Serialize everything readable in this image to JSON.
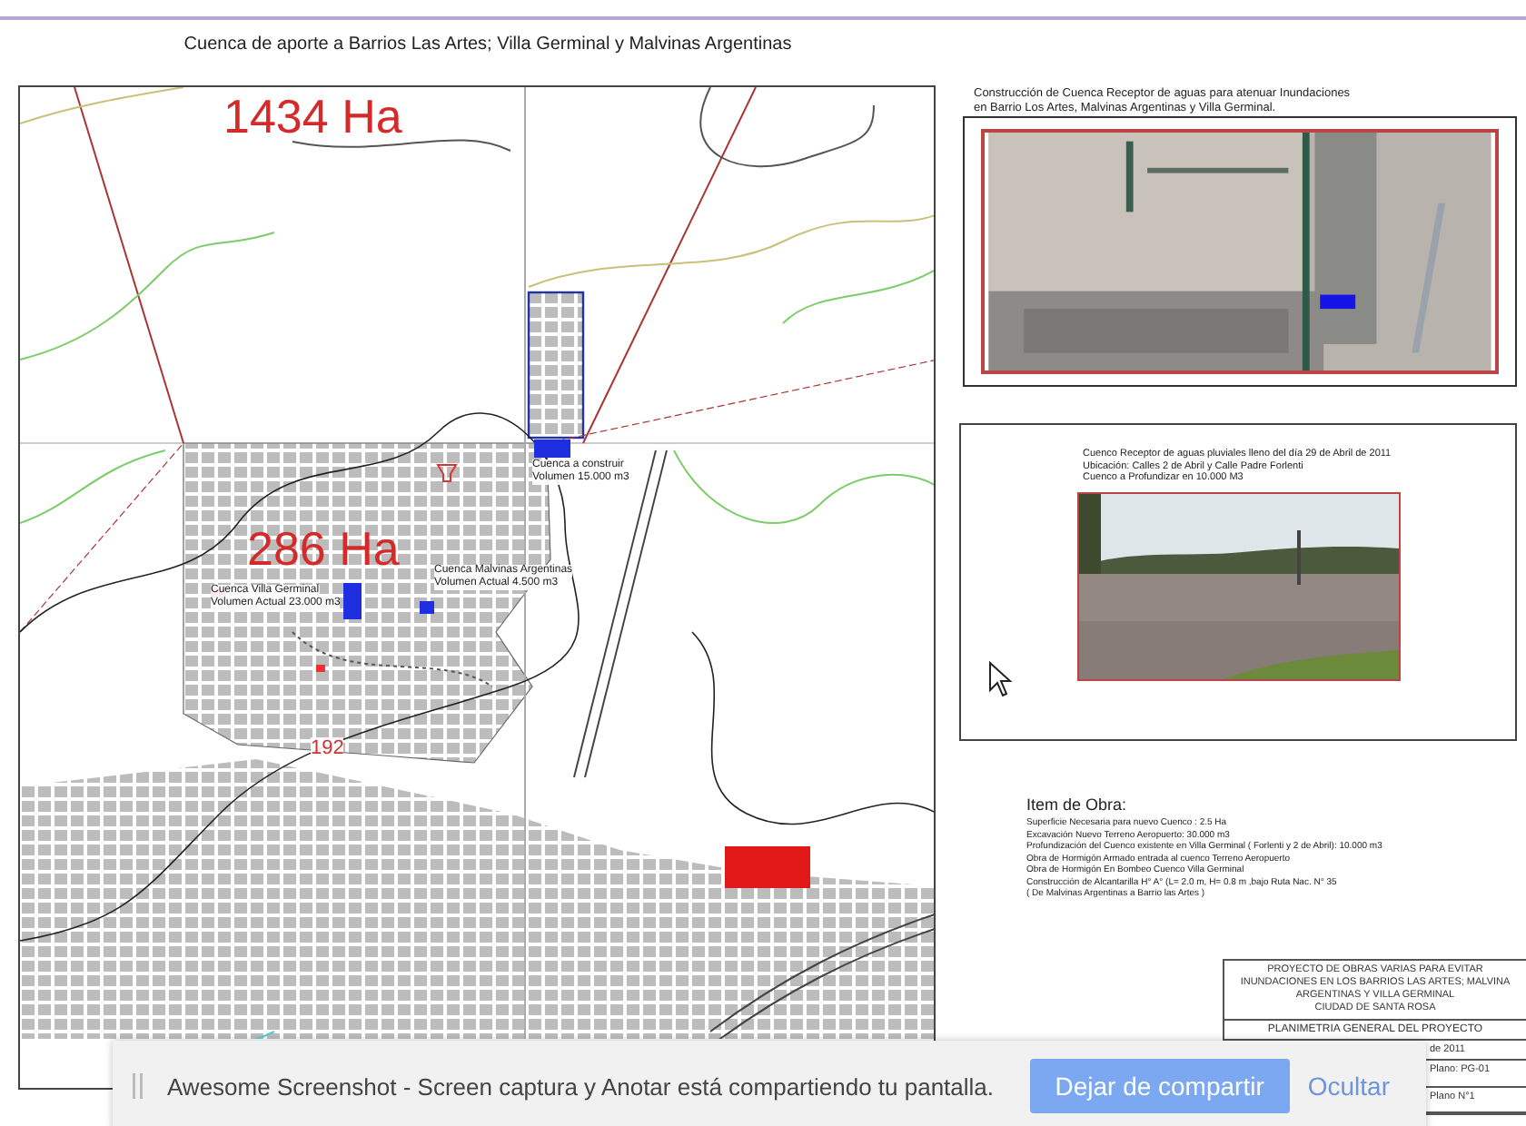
{
  "document": {
    "title": "Cuenca de aporte  a Barrios Las Artes; Villa Germinal y Malvinas Argentinas",
    "map": {
      "labels": [
        {
          "kind": "area",
          "text": "1434 Ha"
        },
        {
          "kind": "area",
          "text": "286 Ha"
        },
        {
          "kind": "road",
          "text": "192"
        },
        {
          "kind": "note",
          "lines": [
            "Cuenca a construir",
            "Volumen  15.000 m3"
          ]
        },
        {
          "kind": "note",
          "lines": [
            "Cuenca Villa Germinal",
            "Volumen Actual 23.000 m3"
          ]
        },
        {
          "kind": "note",
          "lines": [
            "Cuenca Malvinas Argentinas",
            "Volumen Actual 4.500 m3"
          ]
        }
      ]
    },
    "satellite_panel": {
      "caption": [
        "Construcción de Cuenca Receptor de aguas  para atenuar Inundaciones",
        "en Barrio Los Artes, Malvinas Argentinas y Villa Germinal."
      ]
    },
    "photo_panel": {
      "caption": [
        "Cuenco Receptor de aguas pluviales lleno del día 29 de Abril de 2011",
        "Ubicación: Calles 2 de Abril y Calle Padre Forlenti",
        "Cuenco a Profundizar  en  10.000 M3"
      ]
    },
    "works": {
      "heading": "Item de Obra:",
      "items": [
        "Superficie Necesaria para nuevo Cuenco :  2.5 Ha",
        "Excavación Nuevo Terreno  Aeropuerto:  30.000  m3",
        "Profundización del Cuenco existente en Villa Germinal ( Forlenti y 2 de Abril): 10.000 m3",
        "Obra de Hormigón Armado entrada al cuenco Terreno Aeropuerto",
        "Obra de Hormigón En Bombeo Cuenco Villa Germinal",
        "Construcción de Alcantarilla H° A° (L= 2.0 m, H= 0.8 m ,bajo Ruta Nac. N° 35",
        "( De Malvinas Argentinas a Barrio las Artes )"
      ]
    },
    "title_block": {
      "project": [
        "PROYECTO DE OBRAS VARIAS PARA EVITAR",
        "INUNDACIONES EN LOS BARRIOS LAS ARTES; MALVINA",
        "ARGENTINAS Y VILLA GERMINAL",
        "CIUDAD DE SANTA ROSA"
      ],
      "sheet_title": "PLANIMETRIA GENERAL DEL PROYECTO",
      "date": "de 2011",
      "plan_code": "Plano: PG-01",
      "plan_number": "Plano N°1"
    }
  },
  "share_bar": {
    "message": "Awesome Screenshot - Screen captura y Anotar  está compartiendo tu pantalla.",
    "buttons": [
      {
        "label": "Dejar de compartir",
        "kind": "primary"
      },
      {
        "label": "Ocultar",
        "kind": "secondary"
      }
    ]
  }
}
